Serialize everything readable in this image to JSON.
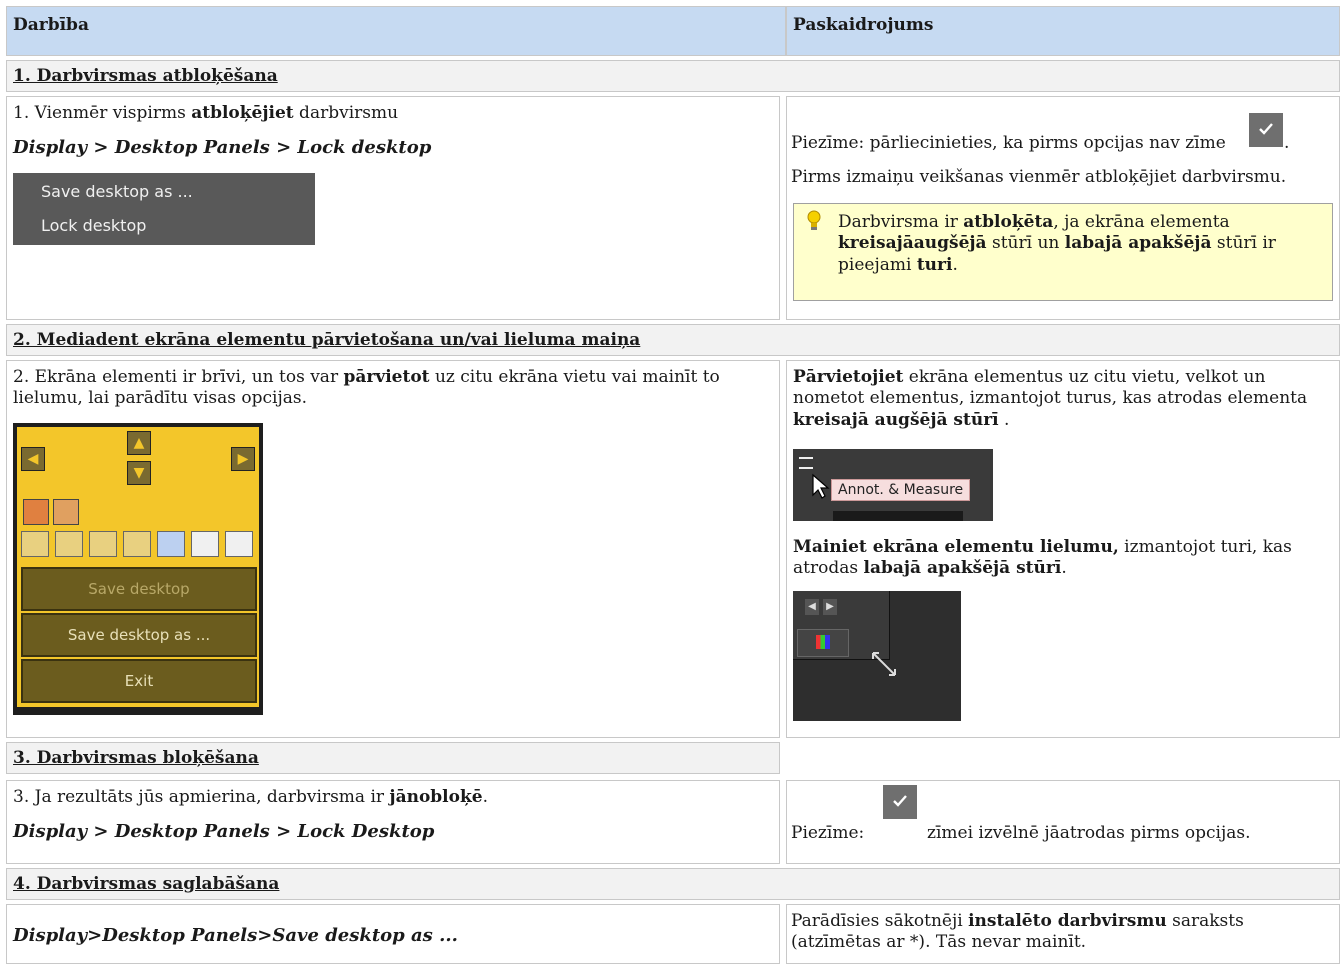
{
  "header": {
    "col1": "Darbība",
    "col2": "Paskaidrojums"
  },
  "s1": {
    "title": "1. Darbvirsmas atbloķēšana",
    "left_pre": "1. Vienmēr vispirms ",
    "left_bold": "atbloķējiet",
    "left_post": " darbvirsmu",
    "path": "Display > Desktop Panels > Lock desktop",
    "menu": [
      "Save desktop as ...",
      "Lock desktop"
    ],
    "note_pre": "Piezīme: pārliecinieties, ka pirms opcijas nav zīme",
    "note_post": ".",
    "note2": "Pirms izmaiņu veikšanas vienmēr atbloķējiet darbvirsmu.",
    "tip": {
      "a": "Darbvirsma ir ",
      "b": "atbloķēta",
      "c": ", ja ekrāna elementa ",
      "d": "kreisajāaugšējā",
      "e": " stūrī un ",
      "f": "labajā apakšējā",
      "g": " stūrī ir pieejami ",
      "h": "turi",
      "i": "."
    }
  },
  "s2": {
    "title": "2. Mediadent ekrāna elementu pārvietošana un/vai lieluma maiņa",
    "left_pre": "2. Ekrāna elementi ir brīvi, un tos var ",
    "left_bold": "pārvietot",
    "left_post": " uz citu ekrāna vietu vai mainīt to lielumu, lai parādītu visas opcijas.",
    "panel_buttons": [
      "Save desktop",
      "Save desktop as ...",
      "Exit"
    ],
    "r1_bold": "Pārvietojiet",
    "r1_post": " ekrāna elementus uz citu vietu, velkot un nometot elementus, izmantojot turus, kas atrodas elementa ",
    "r1_bold2": "kreisajā augšējā stūrī",
    "r1_end": " .",
    "tooltip": "Annot. & Measure",
    "r2_bold": "Mainiet ekrāna elementu lielumu,",
    "r2_post": " izmantojot turi, kas atrodas ",
    "r2_bold2": "labajā apakšējā stūrī",
    "r2_end": "."
  },
  "s3": {
    "title": "3. Darbvirsmas bloķēšana",
    "left_pre": "3. Ja rezultāts jūs apmierina, darbvirsma ir ",
    "left_bold": "jānobloķē",
    "left_post": ".",
    "path": "Display > Desktop Panels > Lock Desktop",
    "note_pre": "Piezīme:",
    "note_post": "zīmei izvēlnē jāatrodas pirms opcijas."
  },
  "s4": {
    "title": "4. Darbvirsmas saglabāšana",
    "path": "Display>Desktop Panels>Save desktop as ...",
    "r_pre": "Parādīsies sākotnēji ",
    "r_bold": "instalēto darbvirsmu",
    "r_post": " saraksts (atzīmētas ar *). Tās nevar mainīt."
  }
}
